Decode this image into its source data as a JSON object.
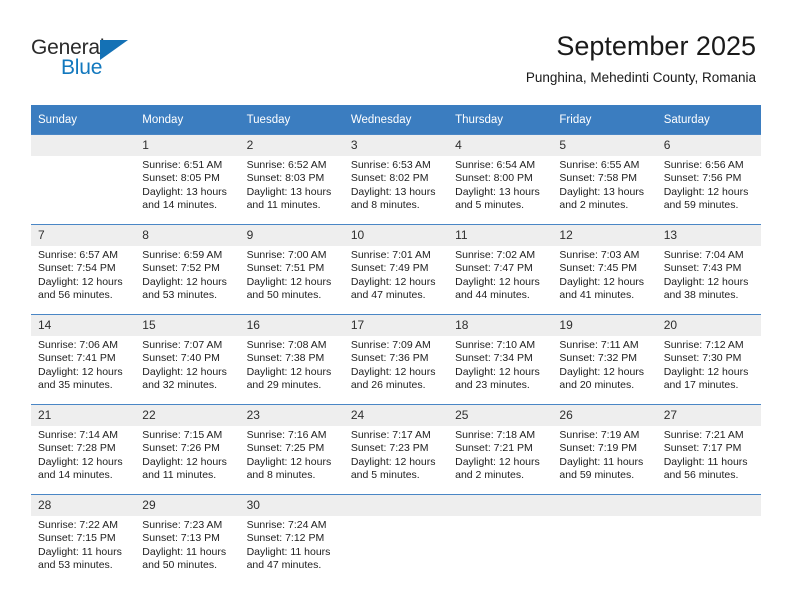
{
  "brand": {
    "name_part1": "General",
    "name_part2": "Blue",
    "triangle_color": "#1471b5",
    "blue_text_color": "#1278be"
  },
  "header": {
    "month_title": "September 2025",
    "location": "Punghina, Mehedinti County, Romania"
  },
  "theme": {
    "header_row_bg": "#3b7dc0",
    "daynum_bg": "#eeeeee",
    "cell_border": "#4a86c5",
    "page_bg": "#ffffff"
  },
  "calendar": {
    "weekday_headers": [
      "Sunday",
      "Monday",
      "Tuesday",
      "Wednesday",
      "Thursday",
      "Friday",
      "Saturday"
    ],
    "labels": {
      "sunrise_prefix": "Sunrise:",
      "sunset_prefix": "Sunset:",
      "daylight_prefix": "Daylight:"
    },
    "weeks": [
      [
        {
          "day": "",
          "empty": true
        },
        {
          "day": "1",
          "sunrise": "Sunrise: 6:51 AM",
          "sunset": "Sunset: 8:05 PM",
          "daylight": "Daylight: 13 hours and 14 minutes."
        },
        {
          "day": "2",
          "sunrise": "Sunrise: 6:52 AM",
          "sunset": "Sunset: 8:03 PM",
          "daylight": "Daylight: 13 hours and 11 minutes."
        },
        {
          "day": "3",
          "sunrise": "Sunrise: 6:53 AM",
          "sunset": "Sunset: 8:02 PM",
          "daylight": "Daylight: 13 hours and 8 minutes."
        },
        {
          "day": "4",
          "sunrise": "Sunrise: 6:54 AM",
          "sunset": "Sunset: 8:00 PM",
          "daylight": "Daylight: 13 hours and 5 minutes."
        },
        {
          "day": "5",
          "sunrise": "Sunrise: 6:55 AM",
          "sunset": "Sunset: 7:58 PM",
          "daylight": "Daylight: 13 hours and 2 minutes."
        },
        {
          "day": "6",
          "sunrise": "Sunrise: 6:56 AM",
          "sunset": "Sunset: 7:56 PM",
          "daylight": "Daylight: 12 hours and 59 minutes."
        }
      ],
      [
        {
          "day": "7",
          "sunrise": "Sunrise: 6:57 AM",
          "sunset": "Sunset: 7:54 PM",
          "daylight": "Daylight: 12 hours and 56 minutes."
        },
        {
          "day": "8",
          "sunrise": "Sunrise: 6:59 AM",
          "sunset": "Sunset: 7:52 PM",
          "daylight": "Daylight: 12 hours and 53 minutes."
        },
        {
          "day": "9",
          "sunrise": "Sunrise: 7:00 AM",
          "sunset": "Sunset: 7:51 PM",
          "daylight": "Daylight: 12 hours and 50 minutes."
        },
        {
          "day": "10",
          "sunrise": "Sunrise: 7:01 AM",
          "sunset": "Sunset: 7:49 PM",
          "daylight": "Daylight: 12 hours and 47 minutes."
        },
        {
          "day": "11",
          "sunrise": "Sunrise: 7:02 AM",
          "sunset": "Sunset: 7:47 PM",
          "daylight": "Daylight: 12 hours and 44 minutes."
        },
        {
          "day": "12",
          "sunrise": "Sunrise: 7:03 AM",
          "sunset": "Sunset: 7:45 PM",
          "daylight": "Daylight: 12 hours and 41 minutes."
        },
        {
          "day": "13",
          "sunrise": "Sunrise: 7:04 AM",
          "sunset": "Sunset: 7:43 PM",
          "daylight": "Daylight: 12 hours and 38 minutes."
        }
      ],
      [
        {
          "day": "14",
          "sunrise": "Sunrise: 7:06 AM",
          "sunset": "Sunset: 7:41 PM",
          "daylight": "Daylight: 12 hours and 35 minutes."
        },
        {
          "day": "15",
          "sunrise": "Sunrise: 7:07 AM",
          "sunset": "Sunset: 7:40 PM",
          "daylight": "Daylight: 12 hours and 32 minutes."
        },
        {
          "day": "16",
          "sunrise": "Sunrise: 7:08 AM",
          "sunset": "Sunset: 7:38 PM",
          "daylight": "Daylight: 12 hours and 29 minutes."
        },
        {
          "day": "17",
          "sunrise": "Sunrise: 7:09 AM",
          "sunset": "Sunset: 7:36 PM",
          "daylight": "Daylight: 12 hours and 26 minutes."
        },
        {
          "day": "18",
          "sunrise": "Sunrise: 7:10 AM",
          "sunset": "Sunset: 7:34 PM",
          "daylight": "Daylight: 12 hours and 23 minutes."
        },
        {
          "day": "19",
          "sunrise": "Sunrise: 7:11 AM",
          "sunset": "Sunset: 7:32 PM",
          "daylight": "Daylight: 12 hours and 20 minutes."
        },
        {
          "day": "20",
          "sunrise": "Sunrise: 7:12 AM",
          "sunset": "Sunset: 7:30 PM",
          "daylight": "Daylight: 12 hours and 17 minutes."
        }
      ],
      [
        {
          "day": "21",
          "sunrise": "Sunrise: 7:14 AM",
          "sunset": "Sunset: 7:28 PM",
          "daylight": "Daylight: 12 hours and 14 minutes."
        },
        {
          "day": "22",
          "sunrise": "Sunrise: 7:15 AM",
          "sunset": "Sunset: 7:26 PM",
          "daylight": "Daylight: 12 hours and 11 minutes."
        },
        {
          "day": "23",
          "sunrise": "Sunrise: 7:16 AM",
          "sunset": "Sunset: 7:25 PM",
          "daylight": "Daylight: 12 hours and 8 minutes."
        },
        {
          "day": "24",
          "sunrise": "Sunrise: 7:17 AM",
          "sunset": "Sunset: 7:23 PM",
          "daylight": "Daylight: 12 hours and 5 minutes."
        },
        {
          "day": "25",
          "sunrise": "Sunrise: 7:18 AM",
          "sunset": "Sunset: 7:21 PM",
          "daylight": "Daylight: 12 hours and 2 minutes."
        },
        {
          "day": "26",
          "sunrise": "Sunrise: 7:19 AM",
          "sunset": "Sunset: 7:19 PM",
          "daylight": "Daylight: 11 hours and 59 minutes."
        },
        {
          "day": "27",
          "sunrise": "Sunrise: 7:21 AM",
          "sunset": "Sunset: 7:17 PM",
          "daylight": "Daylight: 11 hours and 56 minutes."
        }
      ],
      [
        {
          "day": "28",
          "sunrise": "Sunrise: 7:22 AM",
          "sunset": "Sunset: 7:15 PM",
          "daylight": "Daylight: 11 hours and 53 minutes."
        },
        {
          "day": "29",
          "sunrise": "Sunrise: 7:23 AM",
          "sunset": "Sunset: 7:13 PM",
          "daylight": "Daylight: 11 hours and 50 minutes."
        },
        {
          "day": "30",
          "sunrise": "Sunrise: 7:24 AM",
          "sunset": "Sunset: 7:12 PM",
          "daylight": "Daylight: 11 hours and 47 minutes."
        },
        {
          "day": "",
          "empty": true
        },
        {
          "day": "",
          "empty": true
        },
        {
          "day": "",
          "empty": true
        },
        {
          "day": "",
          "empty": true
        }
      ]
    ]
  }
}
